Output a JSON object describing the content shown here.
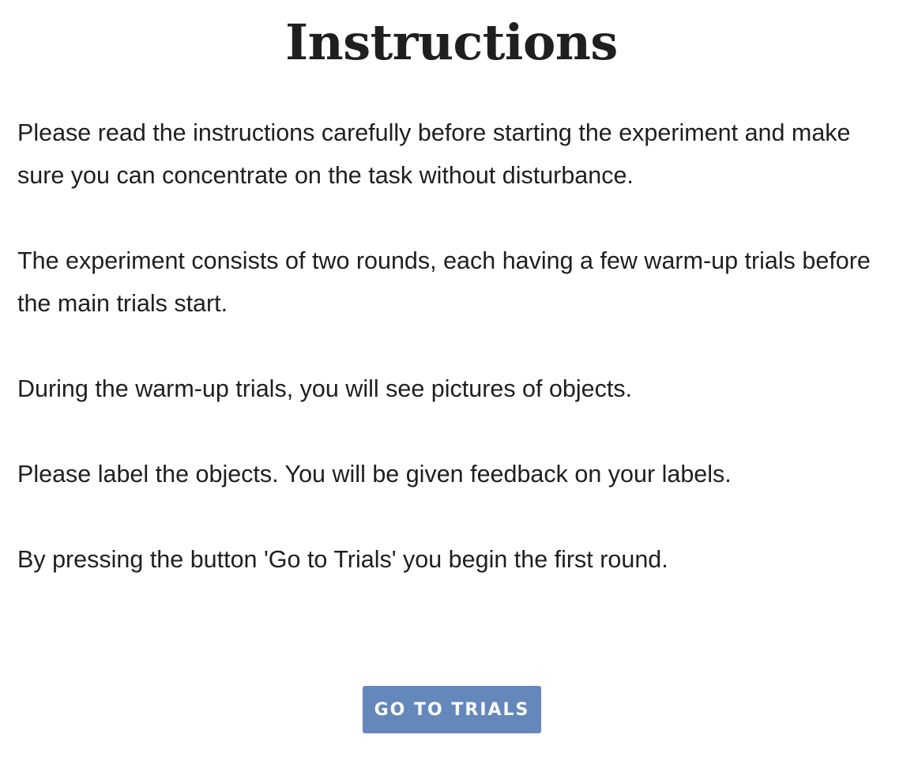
{
  "page": {
    "title": "Instructions",
    "paragraphs": [
      "Please read the instructions carefully before starting the experiment and make sure you can concentrate on the task without disturbance.",
      "The experiment consists of two rounds, each having a few warm-up trials before the main trials start.",
      "During the warm-up trials, you will see pictures of objects.",
      "Please label the objects. You will be given feedback on your labels.",
      "By pressing the button 'Go to Trials' you begin the first round."
    ]
  },
  "actions": {
    "go_to_trials_label": "Go to Trials"
  },
  "colors": {
    "button_bg": "#6488bb",
    "text": "#1f1f1f",
    "background": "#ffffff"
  }
}
